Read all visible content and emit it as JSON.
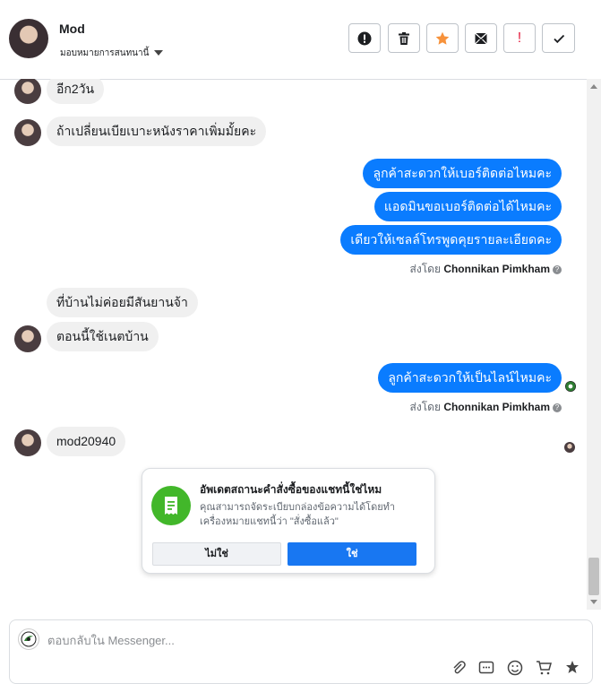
{
  "header": {
    "contact_name": "Mod",
    "assign_label": "มอบหมายการสนทนานี้",
    "toolbar": {
      "spam": "spam-icon",
      "delete": "trash-icon",
      "star": "star-icon",
      "mark_unread": "envelope-icon",
      "follow_up": "!",
      "done": "checkmark-icon"
    }
  },
  "messages": [
    {
      "dir": "in",
      "text": "อีก2วัน"
    },
    {
      "dir": "in",
      "text": "ถ้าเปลี่ยนเบียเบาะหนังราคาเพิ่มมั้ยคะ"
    },
    {
      "dir": "out",
      "text": "ลูกค้าสะดวกให้เบอร์ติดต่อไหมคะ"
    },
    {
      "dir": "out",
      "text": "แอดมินขอเบอร์ติดต่อได้ไหมคะ"
    },
    {
      "dir": "out",
      "text": "เดียวให้เซลล์โทรพูดคุยรายละเอียดคะ"
    },
    {
      "dir": "in",
      "text": "ที่บ้านไม่ค่อยมีสันยานจ้า"
    },
    {
      "dir": "in",
      "text": "ตอนนี้ใช้เนตบ้าน"
    },
    {
      "dir": "out",
      "text": "ลูกค้าสะดวกให้เป็นไลน์ไหมคะ"
    },
    {
      "dir": "in",
      "text": "mod20940"
    }
  ],
  "sent_by": {
    "prefix": "ส่งโดย",
    "name": "Chonnikan Pimkham"
  },
  "order_card": {
    "title": "อัพเดตสถานะคำสั่งซื้อของแชทนี้ใช่ไหม",
    "body": "คุณสามารถจัดระเบียบกล่องข้อความได้โดยทำเครื่องหมายแชทนี้ว่า \"สั่งซื้อแล้ว\"",
    "no_label": "ไม่ใช่",
    "yes_label": "ใช่"
  },
  "composer": {
    "placeholder": "ตอบกลับใน Messenger...",
    "value": "",
    "icons": [
      "attachment-icon",
      "saved-reply-icon",
      "emoji-icon",
      "cart-icon",
      "like-icon"
    ]
  },
  "colors": {
    "accent": "#0a7cff",
    "incoming_bubble": "#f0f0f0",
    "order_icon": "#42b72a",
    "star": "#f7923b",
    "flag": "#e41e3f"
  }
}
